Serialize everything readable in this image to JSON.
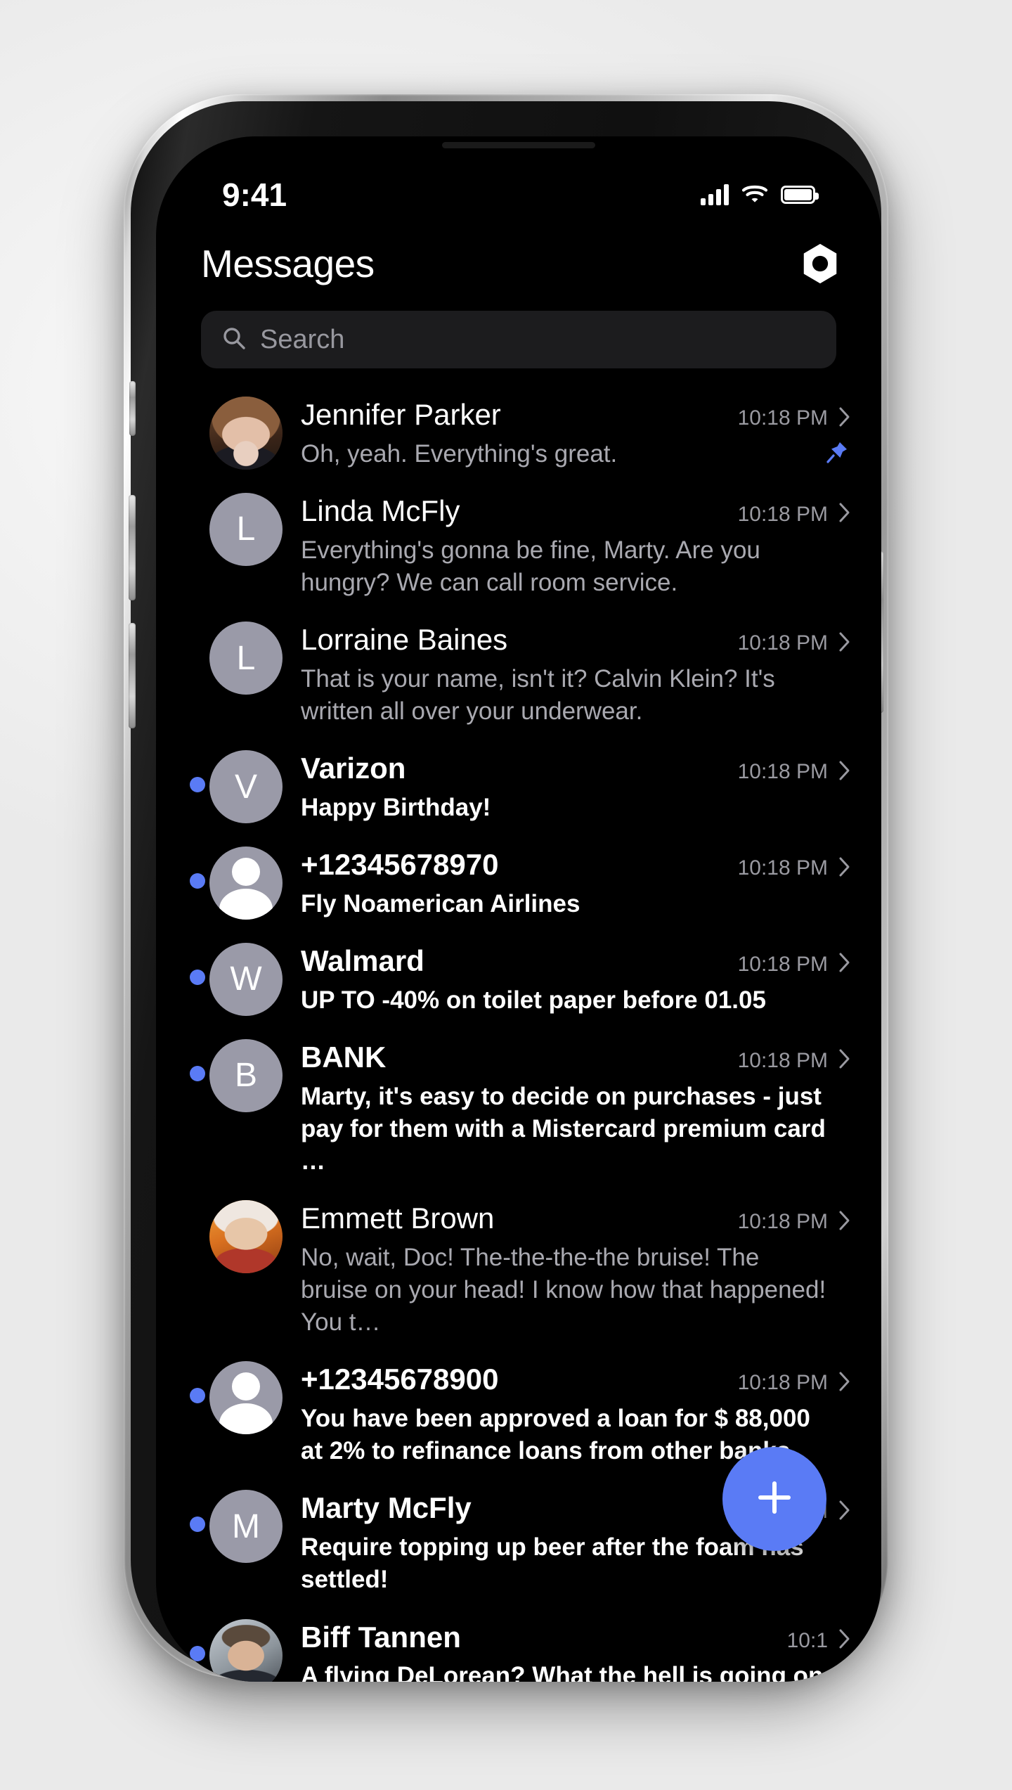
{
  "status_bar": {
    "time": "9:41",
    "cellular_icon": "cellular-signal-icon",
    "wifi_icon": "wifi-icon",
    "battery_icon": "battery-full-icon"
  },
  "header": {
    "title": "Messages",
    "settings_icon": "settings-hex-nut-icon"
  },
  "search": {
    "placeholder": "Search",
    "value": "",
    "icon": "search-icon"
  },
  "fab": {
    "label": "+",
    "icon": "plus-icon",
    "color": "#5a7bf5"
  },
  "colors": {
    "accent": "#5a7bf5",
    "screen_background": "#000000",
    "search_background": "#1c1c1e",
    "avatar_placeholder": "#9a9aa8",
    "name_text": "#ffffff",
    "preview_text": "#a9a9b0",
    "time_text": "#9a9aa1"
  },
  "conversations": [
    {
      "name": "Jennifer Parker",
      "preview": "Oh, yeah. Everything's great.",
      "time": "10:18 PM",
      "unread": false,
      "pinned": true,
      "avatar_type": "photo",
      "avatar_class": "ph-jennifer",
      "initial": ""
    },
    {
      "name": "Linda McFly",
      "preview": "Everything's gonna be fine, Marty. Are you hungry? We can call room service.",
      "time": "10:18 PM",
      "unread": false,
      "pinned": false,
      "avatar_type": "initial",
      "avatar_class": "",
      "initial": "L"
    },
    {
      "name": "Lorraine Baines",
      "preview": "That is your name, isn't it? Calvin Klein? It's written all over your underwear.",
      "time": "10:18 PM",
      "unread": false,
      "pinned": false,
      "avatar_type": "initial",
      "avatar_class": "",
      "initial": "L"
    },
    {
      "name": "Varizon",
      "preview": "Happy Birthday!",
      "time": "10:18 PM",
      "unread": true,
      "pinned": false,
      "avatar_type": "initial",
      "avatar_class": "",
      "initial": "V"
    },
    {
      "name": "+12345678970",
      "preview": "Fly Noamerican Airlines",
      "time": "10:18 PM",
      "unread": true,
      "pinned": false,
      "avatar_type": "person",
      "avatar_class": "",
      "initial": ""
    },
    {
      "name": "Walmard",
      "preview": "UP TO -40% on toilet paper before 01.05",
      "time": "10:18 PM",
      "unread": true,
      "pinned": false,
      "avatar_type": "initial",
      "avatar_class": "",
      "initial": "W"
    },
    {
      "name": "BANK",
      "preview": "Marty, it's easy to decide on purchases - just pay for them with a Mistercard premium card …",
      "time": "10:18 PM",
      "unread": true,
      "pinned": false,
      "avatar_type": "initial",
      "avatar_class": "",
      "initial": "B"
    },
    {
      "name": "Emmett Brown",
      "preview": "No, wait, Doc! The-the-the-the bruise! The bruise on your head! I know how that happened! You t…",
      "time": "10:18 PM",
      "unread": false,
      "pinned": false,
      "avatar_type": "photo",
      "avatar_class": "ph-emmett",
      "initial": ""
    },
    {
      "name": "+12345678900",
      "preview": "You have been approved a loan for $ 88,000 at 2% to refinance loans from other banks.",
      "time": "10:18 PM",
      "unread": true,
      "pinned": false,
      "avatar_type": "person",
      "avatar_class": "",
      "initial": ""
    },
    {
      "name": "Marty McFly",
      "preview": "Require topping up beer after the foam has settled!",
      "time": "10:18 PM",
      "unread": true,
      "pinned": false,
      "avatar_type": "initial",
      "avatar_class": "",
      "initial": "M"
    },
    {
      "name": "Biff Tannen",
      "preview": "A flying DeLorean? What the hell is going on here?",
      "time": "10:1",
      "unread": true,
      "pinned": false,
      "avatar_type": "photo",
      "avatar_class": "ph-biff",
      "initial": ""
    }
  ],
  "device": {
    "mute_switch": "mute-switch",
    "volume_up": "volume-up-button",
    "volume_down": "volume-down-button",
    "power": "power-button",
    "speaker": "earpiece-speaker"
  }
}
